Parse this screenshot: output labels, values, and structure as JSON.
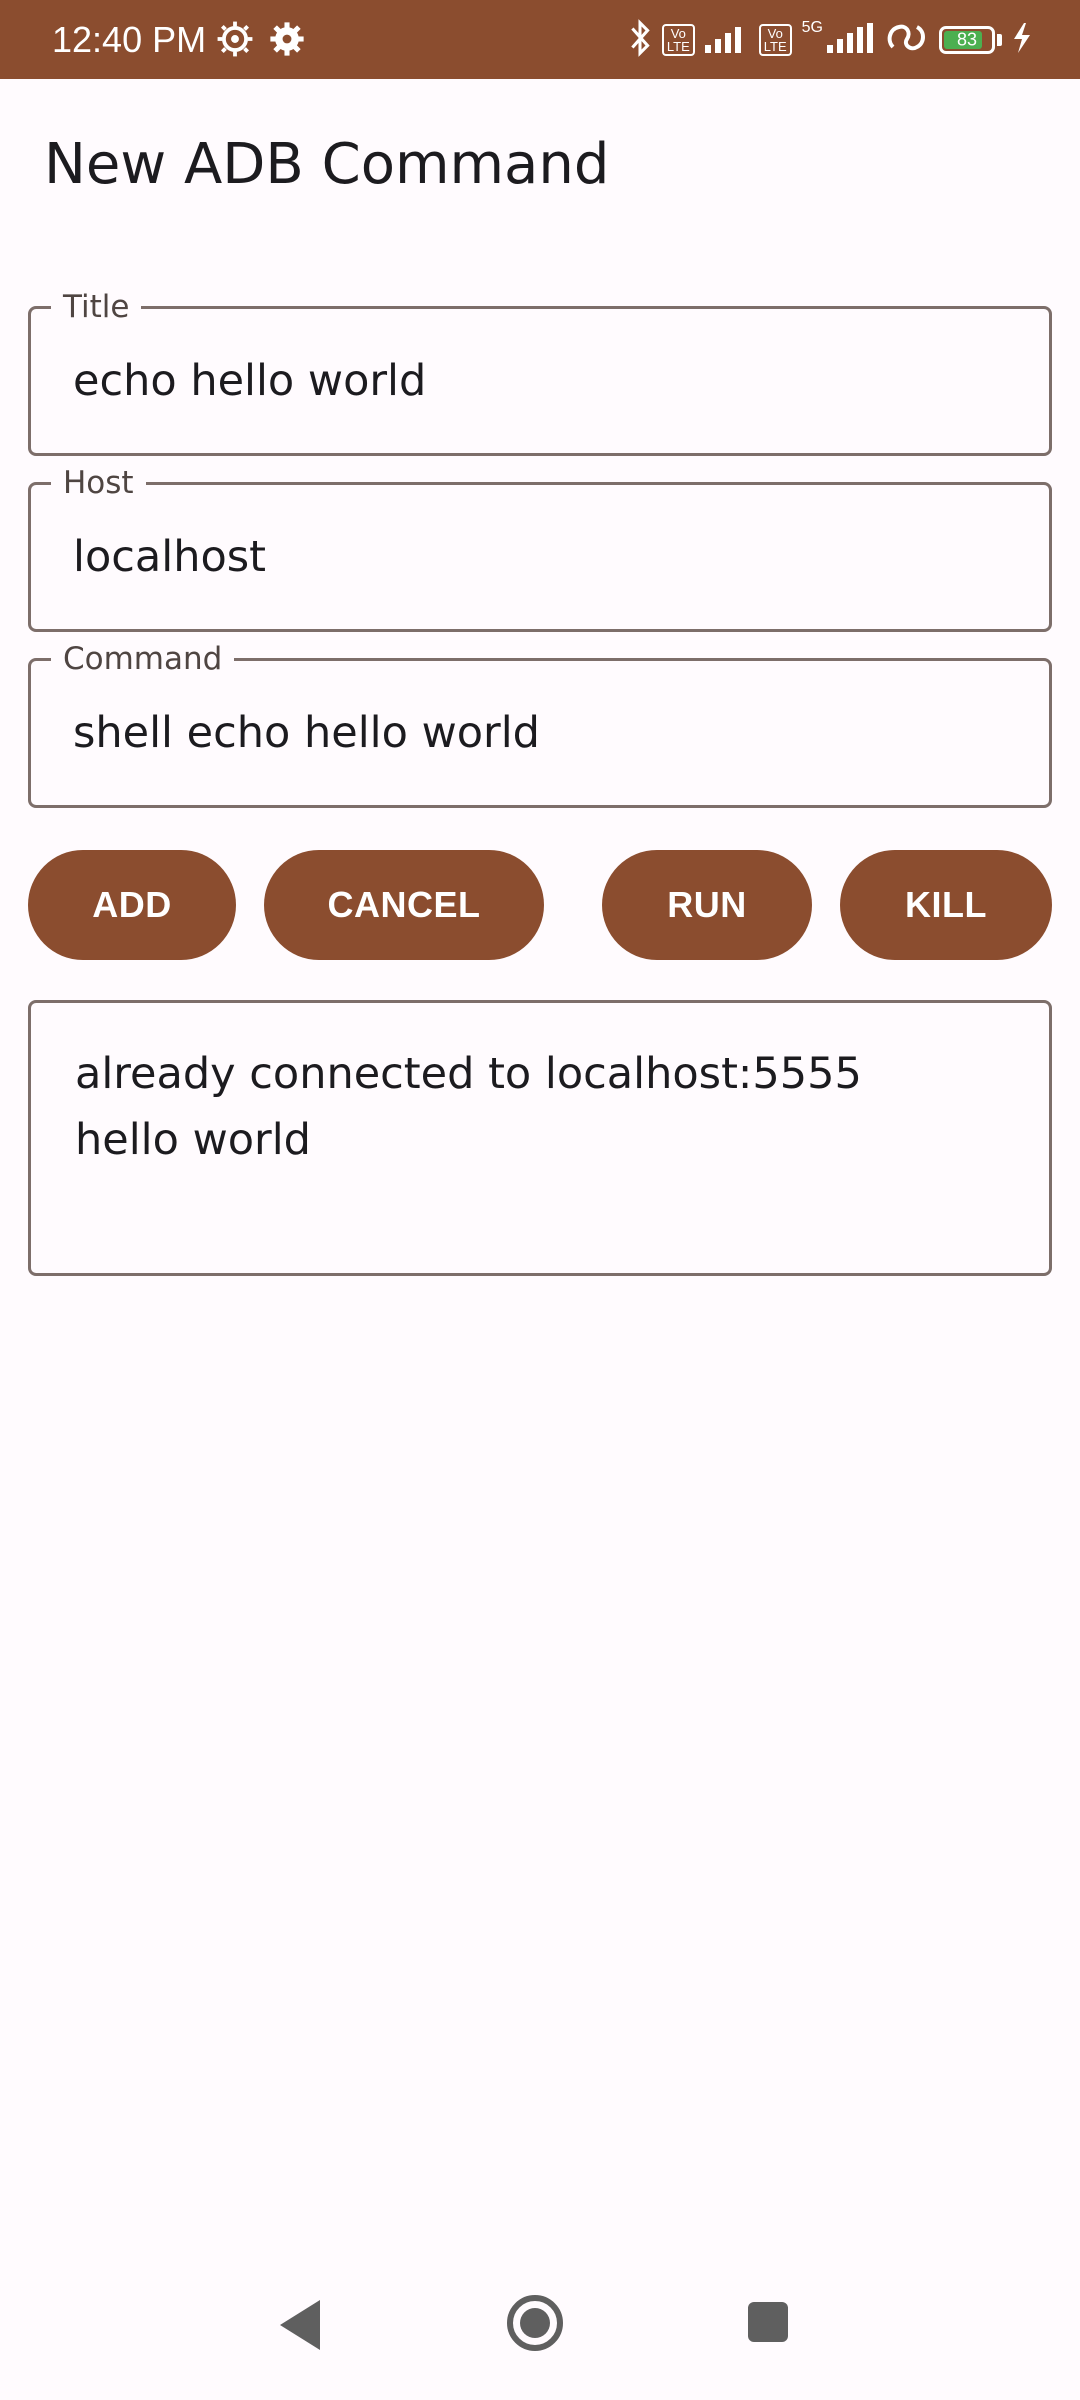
{
  "status_bar": {
    "time": "12:40 PM",
    "volte1": "Vo\nLTE",
    "volte2": "Vo\nLTE",
    "network": "5G",
    "battery_level": "83",
    "battery_fraction": 0.83,
    "icons": [
      "settings-gear-icon",
      "settings-gear-icon",
      "bluetooth-icon",
      "signal-icon",
      "signal-icon",
      "hotspot-icon",
      "battery-icon",
      "charging-bolt-icon"
    ]
  },
  "page": {
    "title": "New ADB Command"
  },
  "form": {
    "title": {
      "label": "Title",
      "value": "echo hello world"
    },
    "host": {
      "label": "Host",
      "value": "localhost"
    },
    "command": {
      "label": "Command",
      "value": "shell echo hello world"
    }
  },
  "actions": {
    "add": "ADD",
    "cancel": "CANCEL",
    "run": "RUN",
    "kill": "KILL"
  },
  "output": {
    "lines": [
      "already connected to localhost:5555",
      "hello world"
    ]
  },
  "colors": {
    "primary": "#8B4D2F",
    "background": "#FFFBFE",
    "outline": "#7D6E6A"
  }
}
